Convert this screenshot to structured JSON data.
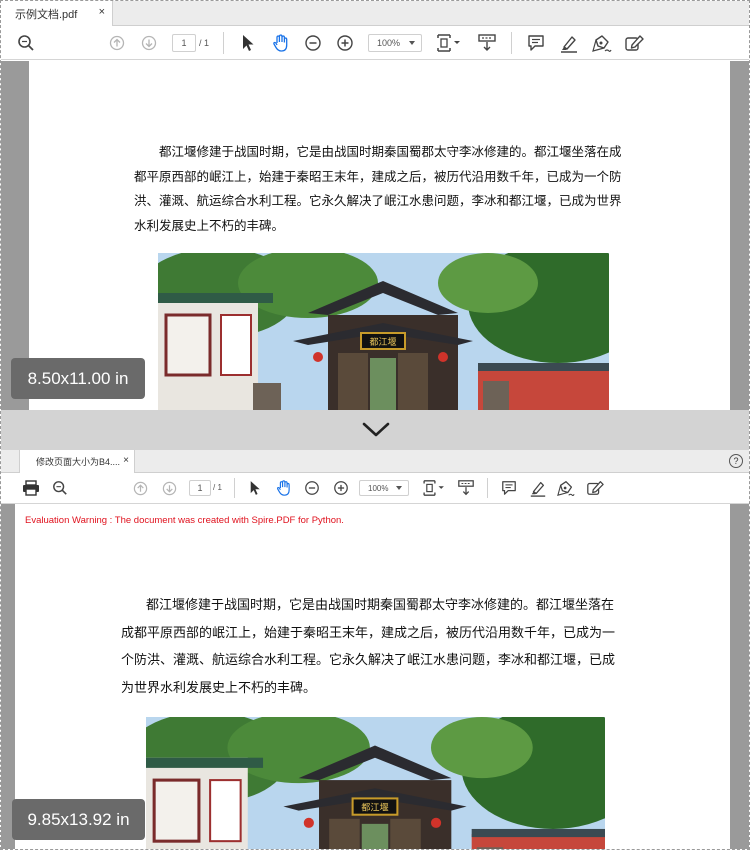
{
  "top_viewer": {
    "tab_title": "示例文档.pdf",
    "tab_close": "×",
    "page_current": "1",
    "page_total": "/ 1",
    "zoom": "100%",
    "size_badge": "8.50x11.00 in"
  },
  "bottom_viewer": {
    "tab_title": "修改页面大小为B4....",
    "tab_close": "×",
    "help": "?",
    "page_current": "1",
    "page_total": "/ 1",
    "zoom": "100%",
    "evaluation_warning": "Evaluation Warning : The document was created with Spire.PDF for Python.",
    "size_badge": "9.85x13.92 in"
  },
  "document": {
    "paragraph": "都江堰修建于战国时期，它是由战国时期秦国蜀郡太守李冰修建的。都江堰坐落在成都平原西部的岷江上，始建于秦昭王末年，建成之后，被历代沿用数千年，已成为一个防洪、灌溉、航运综合水利工程。它永久解决了岷江水患问题，李冰和都江堰，已成为世界水利发展史上不朽的丰碑。",
    "gate_plaque": "都江堰"
  },
  "colors": {
    "viewer_background": "#9a9a9a",
    "divider": "#d3d3d3",
    "warning_text": "#e0121e",
    "active_tool": "#1a73e8"
  },
  "icons": [
    "zoom-icon",
    "page-up-icon",
    "page-down-icon",
    "select-arrow-icon",
    "hand-tool-icon",
    "zoom-out-icon",
    "zoom-in-icon",
    "fit-page-icon",
    "scroll-mode-icon",
    "comment-icon",
    "highlight-icon",
    "sign-icon",
    "edit-icon",
    "print-icon",
    "chevron-down-icon"
  ]
}
